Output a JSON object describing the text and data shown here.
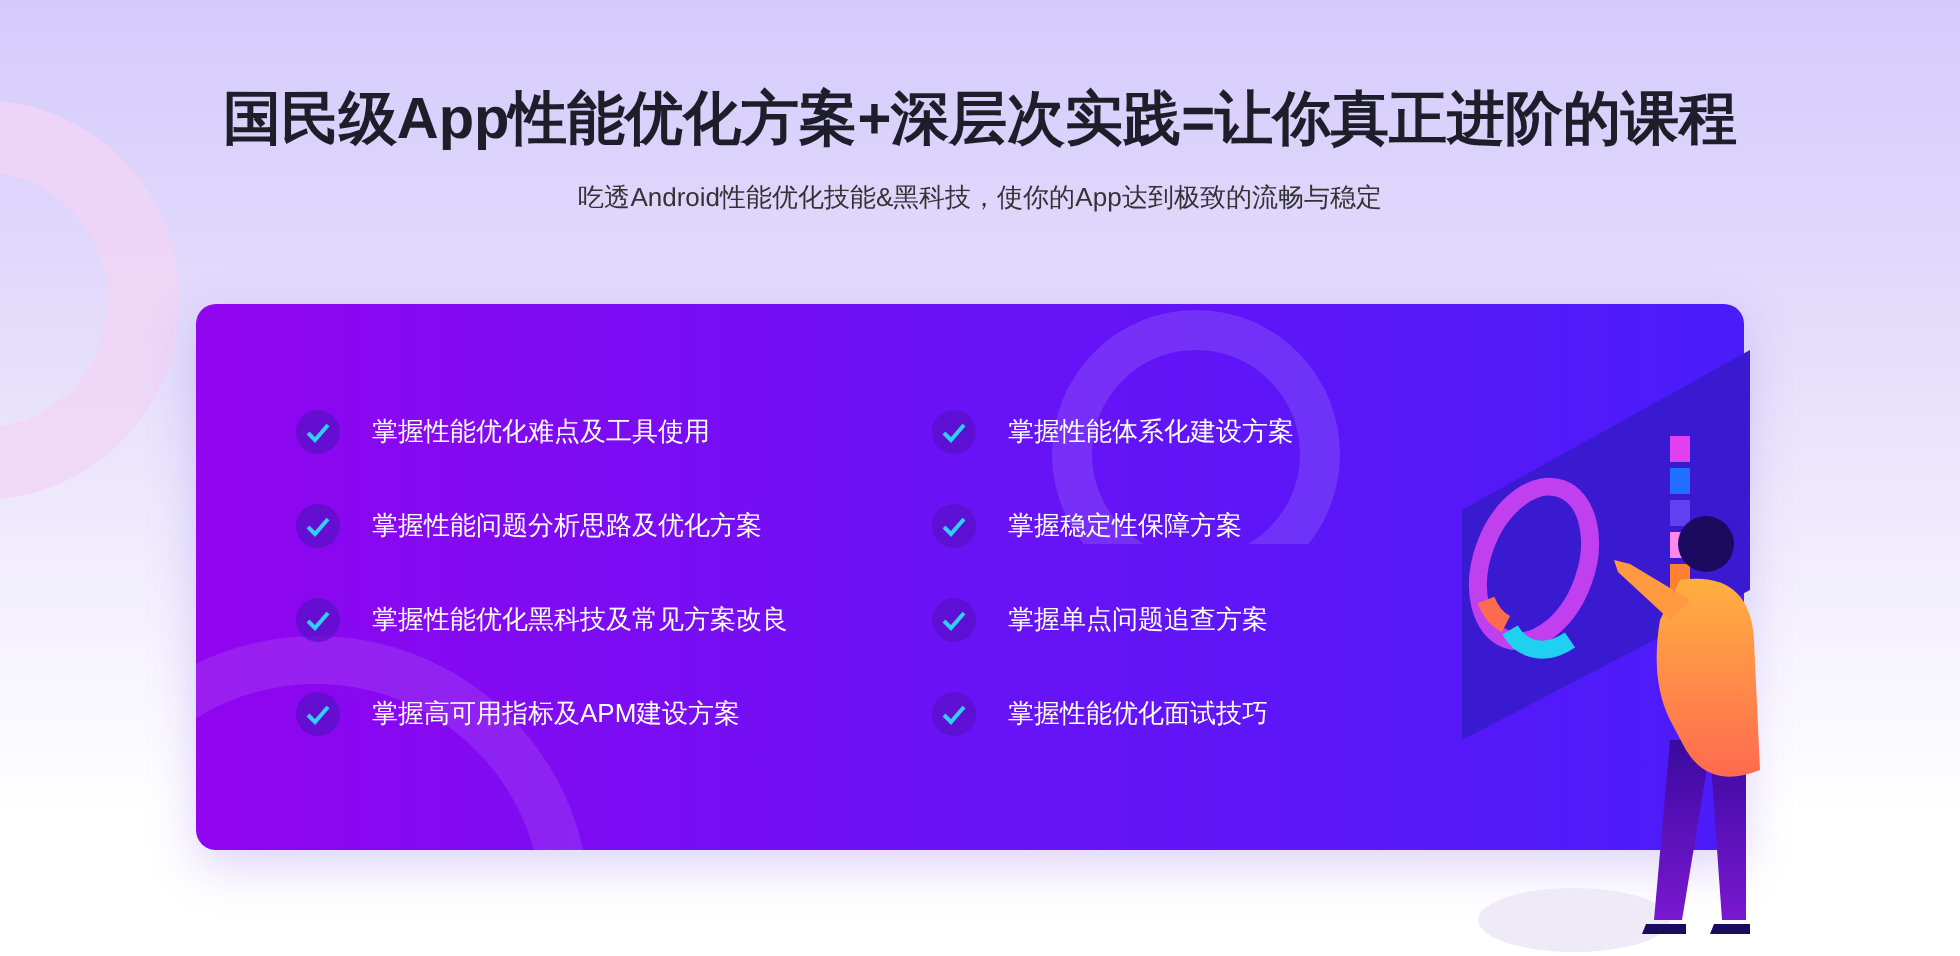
{
  "title": "国民级App性能优化方案+深层次实践=让你真正进阶的课程",
  "subtitle": "吃透Android性能优化技能&黑科技，使你的App达到极致的流畅与稳定",
  "features": [
    {
      "text": "掌握性能优化难点及工具使用"
    },
    {
      "text": "掌握性能问题分析思路及优化方案"
    },
    {
      "text": "掌握性能优化黑科技及常见方案改良"
    },
    {
      "text": "掌握高可用指标及APM建设方案"
    },
    {
      "text": "掌握性能体系化建设方案"
    },
    {
      "text": "掌握稳定性保障方案"
    },
    {
      "text": "掌握单点问题追查方案"
    },
    {
      "text": "掌握性能优化面试技巧"
    }
  ]
}
